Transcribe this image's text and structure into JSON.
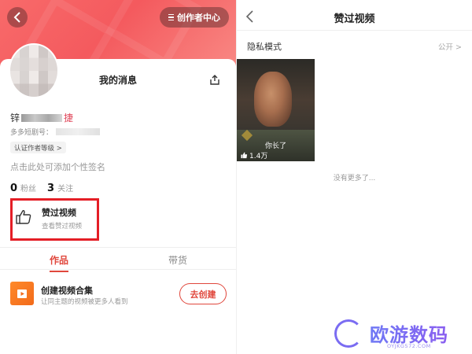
{
  "left": {
    "creator_center": "创作者中心",
    "message_title": "我的消息",
    "nickname_head": "锌",
    "nickname_tail": "捷",
    "doukey_label": "多多短剧号：",
    "cert_label": "认证作者等级 >",
    "signature": "点击此处可添加个性签名",
    "stats": {
      "followers_num": "0",
      "followers_label": "粉丝",
      "following_num": "3",
      "following_label": "关注"
    },
    "liked": {
      "title": "赞过视频",
      "subtitle": "查看赞过视频"
    },
    "tabs": {
      "works": "作品",
      "goods": "带货"
    },
    "collection": {
      "title": "创建视频合集",
      "subtitle": "让同主题的视频被更多人看到",
      "button": "去创建"
    }
  },
  "right": {
    "title": "赞过视频",
    "privacy_label": "隐私模式",
    "privacy_value": "公开 >",
    "video": {
      "caption": "你长了",
      "likes": "1.4万"
    },
    "no_more": "没有更多了..."
  },
  "watermark": {
    "text": "欧游数码",
    "url": "OYJKG572.COM"
  },
  "colors": {
    "brand_red": "#e0473c",
    "highlight_box": "#e41e26",
    "banner": "#f45a5e"
  }
}
